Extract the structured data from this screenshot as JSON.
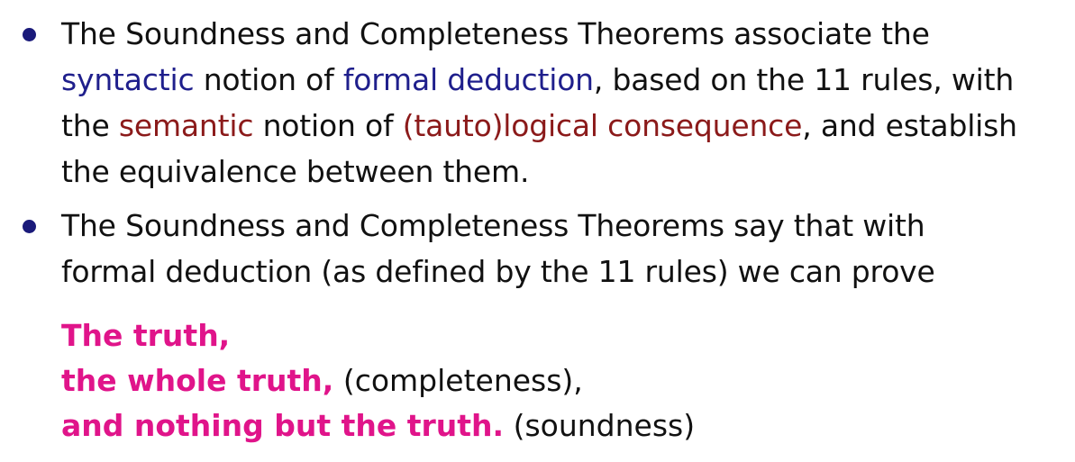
{
  "bullets": [
    {
      "lines": [
        {
          "t1": "The Soundness and Completeness Theorems associate the"
        },
        {
          "s1": "syntactic",
          "t2": " notion of ",
          "s2": "formal deduction",
          "t3": ", based on the 11 rules, with"
        },
        {
          "t1": "the ",
          "s1": "semantic",
          "t2": " notion of ",
          "s2": "(tauto)logical consequence",
          "t3": ", and establish"
        },
        {
          "t1": "the equivalence between them."
        }
      ]
    },
    {
      "lines": [
        {
          "t1": "The Soundness and Completeness Theorems say that with"
        },
        {
          "t1": "formal deduction (as defined by the 11 rules) we can prove"
        }
      ]
    }
  ],
  "truth": {
    "line1": "The truth,",
    "line2_bold": "the whole truth,",
    "line2_plain": " (completeness),",
    "line3_bold": "and nothing but the truth.",
    "line3_plain": " (soundness)"
  },
  "colors": {
    "syntactic": "#1f1f8c",
    "semantic": "#8b1a1a",
    "emphasis": "#e0148a",
    "bullet": "#1a1a7a"
  }
}
